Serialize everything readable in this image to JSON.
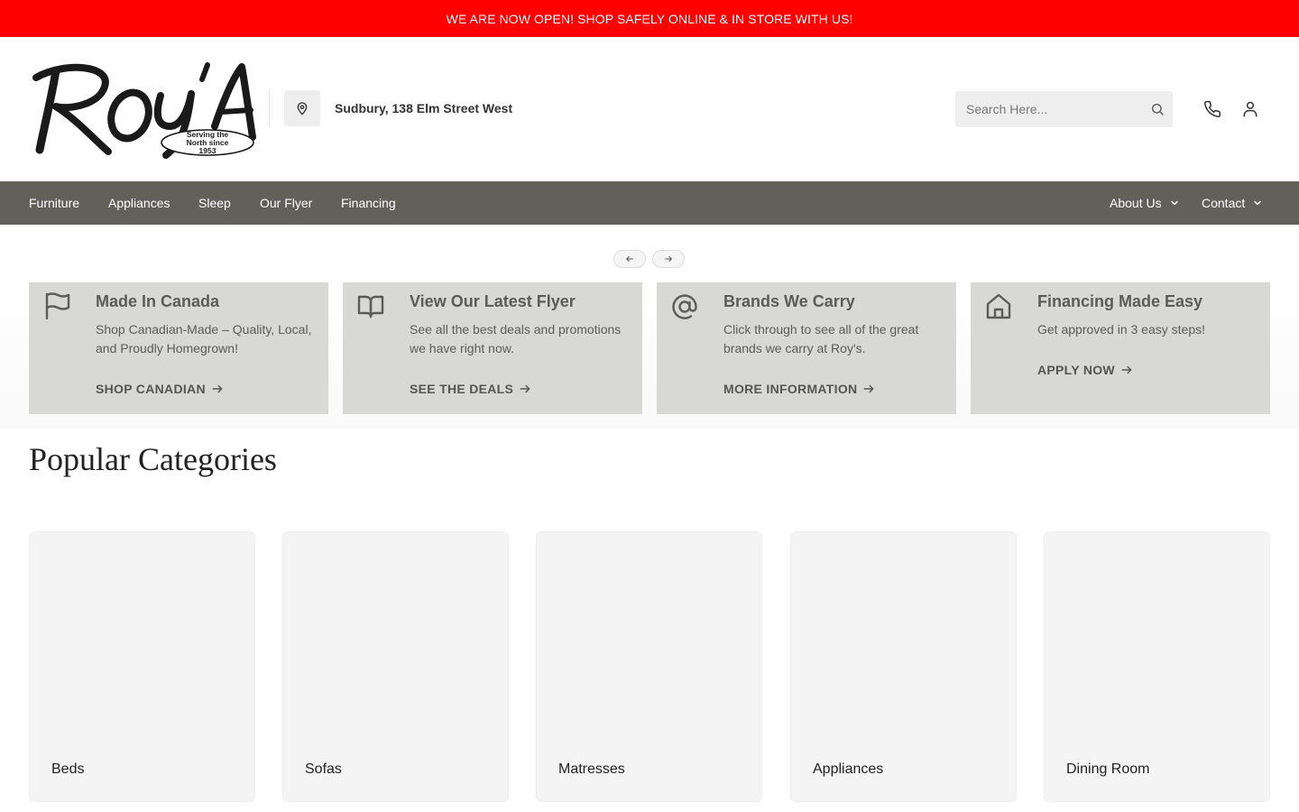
{
  "announcement": "WE ARE NOW OPEN! SHOP SAFELY ONLINE & IN STORE WITH US!",
  "brand": {
    "logo_text": "RoY'S",
    "tagline": [
      "Serving the",
      "North since",
      "1953"
    ]
  },
  "location": "Sudbury, 138 Elm Street West",
  "search": {
    "placeholder": "Search Here..."
  },
  "header_icons": [
    "phone-icon",
    "user-icon"
  ],
  "nav": {
    "left": [
      "Furniture",
      "Appliances",
      "Sleep",
      "Our Flyer",
      "Financing"
    ],
    "right": [
      "About Us",
      "Contact"
    ]
  },
  "carousel": {
    "prev_icon": "arrow-left-icon",
    "next_icon": "arrow-right-icon"
  },
  "promos": [
    {
      "icon": "flag-icon",
      "title": "Made In Canada",
      "desc": "Shop Canadian-Made – Quality, Local, and Proudly Homegrown!",
      "link": "SHOP CANADIAN"
    },
    {
      "icon": "book-open-icon",
      "title": "View Our Latest Flyer",
      "desc": "See all the best deals and promotions we have right now.",
      "link": "SEE THE DEALS"
    },
    {
      "icon": "at-sign-icon",
      "title": "Brands We Carry",
      "desc": "Click through to see all of the great brands we carry at Roy's.",
      "link": "MORE INFORMATION"
    },
    {
      "icon": "home-icon",
      "title": "Financing Made Easy",
      "desc": "Get approved in 3 easy steps!",
      "link": "APPLY NOW"
    }
  ],
  "popular": {
    "title": "Popular Categories",
    "categories": [
      "Beds",
      "Sofas",
      "Matresses",
      "Appliances",
      "Dining Room"
    ]
  },
  "colors": {
    "announcement_bg": "#ff0000",
    "nav_bg": "#616159",
    "card_bg": "#d8d8d6"
  }
}
